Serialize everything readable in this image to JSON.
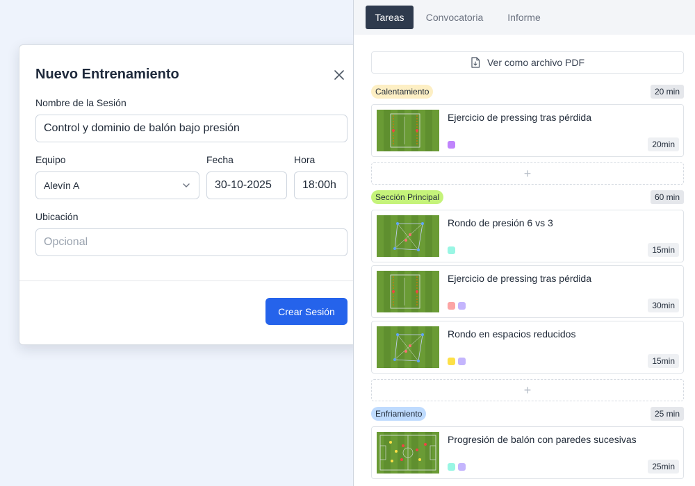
{
  "modal": {
    "title": "Nuevo Entrenamiento",
    "session_name_label": "Nombre de la Sesión",
    "session_name_value": "Control y dominio de balón bajo presión",
    "team_label": "Equipo",
    "team_value": "Alevín A",
    "date_label": "Fecha",
    "date_value": "30-10-2025",
    "time_label": "Hora",
    "time_value": "18:00h",
    "location_label": "Ubicación",
    "location_placeholder": "Opcional",
    "submit_label": "Crear Sesión"
  },
  "tabs": [
    {
      "label": "Tareas",
      "active": true
    },
    {
      "label": "Convocatoria",
      "active": false
    },
    {
      "label": "Informe",
      "active": false
    }
  ],
  "pdf_button": {
    "label": "Ver como archivo PDF",
    "icon": "pdf-file-icon"
  },
  "add_symbol": "+",
  "sections": [
    {
      "name": "Calentamiento",
      "color": "#fdefc4",
      "duration": "20 min",
      "tasks": [
        {
          "title": "Ejercicio de pressing tras pérdida",
          "duration": "20min",
          "tags": [
            "#c084fc"
          ],
          "diagram": "pressing"
        }
      ]
    },
    {
      "name": "Sección Principal",
      "color": "#c5f37a",
      "duration": "60 min",
      "tasks": [
        {
          "title": "Rondo de presión 6 vs 3",
          "duration": "15min",
          "tags": [
            "#99f6e4"
          ],
          "diagram": "rondo"
        },
        {
          "title": "Ejercicio de pressing tras pérdida",
          "duration": "30min",
          "tags": [
            "#fca5a5",
            "#c4b5fd"
          ],
          "diagram": "pressing"
        },
        {
          "title": "Rondo en espacios reducidos",
          "duration": "15min",
          "tags": [
            "#fde047",
            "#c4b5fd"
          ],
          "diagram": "rondo"
        }
      ]
    },
    {
      "name": "Enfriamiento",
      "color": "#bfdbfe",
      "duration": "25 min",
      "tasks": [
        {
          "title": "Progresión de balón con paredes sucesivas",
          "duration": "25min",
          "tags": [
            "#99f6e4",
            "#c4b5fd"
          ],
          "diagram": "field"
        }
      ]
    }
  ]
}
